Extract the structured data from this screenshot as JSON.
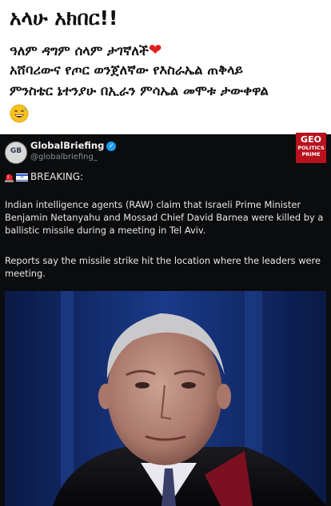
{
  "caption": {
    "title": "አላሁ አክበር!!",
    "line1": "ዓለም ዳግም ሰላም ታገኛለች",
    "line1_emoji": "❤",
    "line2": "አሸባሪውና የጦር ወንጀለኛው የእስራኤል ጠቅላይ",
    "line3": "ምንስቴር ኔተንያሁ በኢራን ምሳኤል መሞቱ ታውቀዋል",
    "line4_emoji": "grinning-sweat-face"
  },
  "post": {
    "account_name": "GlobalBriefing",
    "account_handle": "@globalbriefing_",
    "avatar_text": "GB",
    "brand_line1": "GEO",
    "brand_line2": "POLITICS",
    "brand_line3": "PRIME",
    "breaking_label": "BREAKING:",
    "paragraph1": "Indian intelligence agents (RAW) claim that Israeli Prime Minister Benjamin Netanyahu and Mossad Chief David Barnea were killed by a ballistic missile during a meeting in Tel Aviv.",
    "paragraph2": "Reports say the missile strike hit the location where the leaders were meeting."
  },
  "colors": {
    "card_background": "#0b0c0e",
    "brand_red": "#b7121e",
    "verified_blue": "#1d9bf0",
    "heart_red": "#e0211f"
  },
  "icons": [
    "red-heart-icon",
    "grinning-sweat-emoji-icon",
    "verified-badge-icon",
    "siren-icon",
    "israel-flag-icon"
  ]
}
